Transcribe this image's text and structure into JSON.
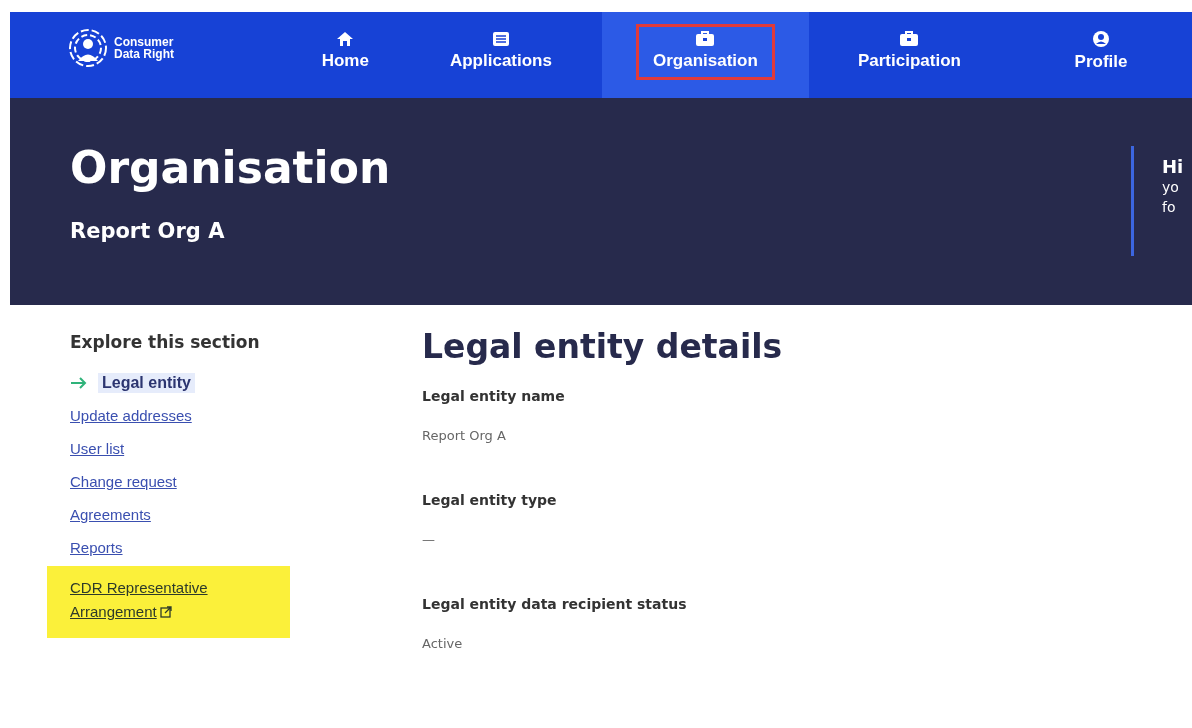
{
  "logo": {
    "line_1": "Consumer",
    "line_2": "Data Right"
  },
  "nav": [
    {
      "label": "Home",
      "kind": "home",
      "selected": false,
      "highlighted": false
    },
    {
      "label": "Applications",
      "kind": "list",
      "selected": false,
      "highlighted": false
    },
    {
      "label": "Organisation",
      "kind": "briefcase",
      "selected": true,
      "highlighted": true
    },
    {
      "label": "Participation",
      "kind": "briefcase",
      "selected": false,
      "highlighted": false
    },
    {
      "label": "Profile",
      "kind": "user",
      "selected": false,
      "highlighted": false
    }
  ],
  "hero": {
    "title": "Organisation",
    "subtitle": "Report Org A",
    "callout": {
      "title": "Hi",
      "lines": [
        "yo",
        "fo"
      ]
    }
  },
  "sidebar": {
    "heading": "Explore this section",
    "items": [
      {
        "label": "Legal entity",
        "selected": true,
        "external": false,
        "highlighted": false
      },
      {
        "label": "Update addresses",
        "selected": false,
        "external": false,
        "highlighted": false
      },
      {
        "label": "User list",
        "selected": false,
        "external": false,
        "highlighted": false
      },
      {
        "label": "Change request",
        "selected": false,
        "external": false,
        "highlighted": false
      },
      {
        "label": "Agreements",
        "selected": false,
        "external": false,
        "highlighted": false
      },
      {
        "label": "Reports",
        "selected": false,
        "external": false,
        "highlighted": false
      },
      {
        "label": "CDR Representative Arrangement",
        "selected": false,
        "external": true,
        "highlighted": true
      }
    ]
  },
  "main": {
    "title": "Legal entity details",
    "fields": [
      {
        "label": "Legal entity name",
        "value": "Report Org A"
      },
      {
        "label": "Legal entity type",
        "value": "—"
      },
      {
        "label": "Legal entity data recipient status",
        "value": "Active"
      }
    ]
  }
}
